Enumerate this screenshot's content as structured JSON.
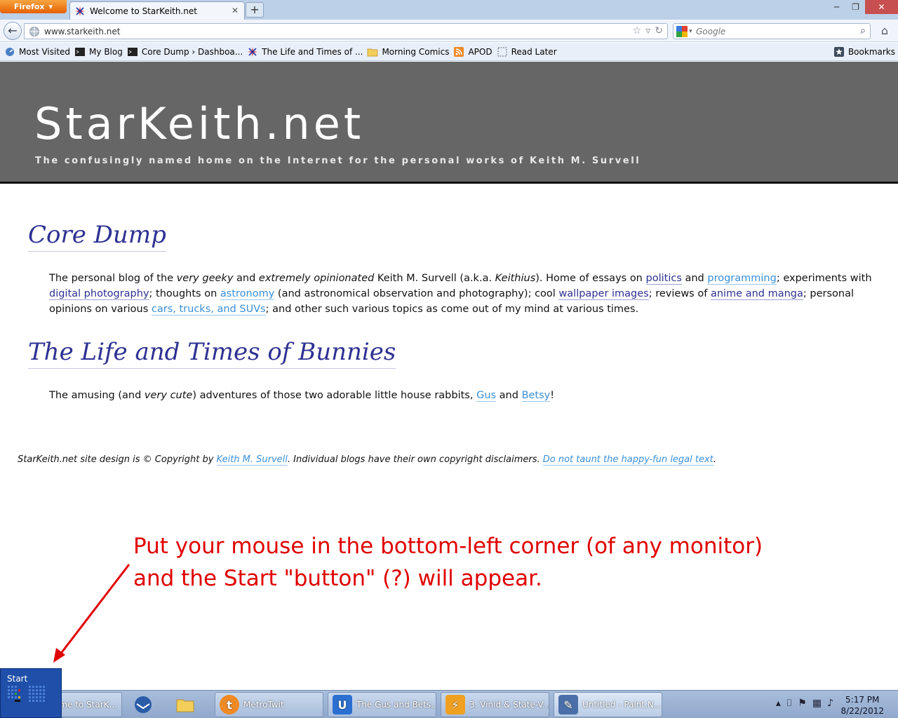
{
  "browser": {
    "app_button": "Firefox",
    "tab_title": "Welcome to StarKeith.net",
    "url": "www.starkeith.net",
    "search_placeholder": "Google",
    "bookmarks": [
      "Most Visited",
      "My Blog",
      "Core Dump › Dashboa...",
      "The Life and Times of ...",
      "Morning Comics",
      "APOD",
      "Read Later"
    ],
    "bookmarks_menu": "Bookmarks"
  },
  "site": {
    "title": "StarKeith.net",
    "tagline": "The confusingly named home on the Internet for the personal works of Keith M. Survell"
  },
  "blogs": [
    {
      "title": "Core Dump",
      "desc": {
        "t1": "The personal blog of the ",
        "e1": "very geeky",
        "t2": " and ",
        "e2": "extremely opinionated",
        "t3": " Keith M. Survell (a.k.a. ",
        "e3": "Keithius",
        "t4": "). Home of essays on ",
        "l1": "politics",
        "t5": " and ",
        "l2": "programming",
        "t6": "; experiments with ",
        "l3": "digital photography",
        "t7": "; thoughts on ",
        "l4": "astronomy",
        "t8": " (and astronomical observation and photography); cool ",
        "l5": "wallpaper images",
        "t9": "; reviews of ",
        "l6": "anime and manga",
        "t10": "; personal opinions on various ",
        "l7": "cars, trucks, and SUVs",
        "t11": "; and other such various topics as come out of my mind at various times."
      }
    },
    {
      "title": "The Life and Times of Bunnies",
      "desc": {
        "t1": "The amusing (and ",
        "e1": "very cute",
        "t2": ") adventures of those two adorable little house rabbits, ",
        "l1": "Gus",
        "t3": " and ",
        "l2": "Betsy",
        "t4": "!"
      }
    }
  ],
  "footer": {
    "t1": "StarKeith.net site design is © Copyright by ",
    "l1": "Keith M. Survell",
    "t2": ". Individual blogs have their own copyright disclaimers. ",
    "l2": "Do not taunt the happy-fun legal text",
    "t3": "."
  },
  "annotation": {
    "line1": "Put your mouse in the bottom-left corner (of any monitor)",
    "line2": "and the Start \"button\" (?) will appear."
  },
  "start_tip": "Start",
  "taskbar": {
    "items": [
      "ome to StarK...",
      "MetroTwit",
      "The Gus and Bets...",
      "3. Vinid & State-V...",
      "Untitled - Paint.N..."
    ],
    "clock_time": "5:17 PM",
    "clock_date": "8/22/2012"
  },
  "colors": {
    "header_bg": "#666666",
    "blog_title": "#2e3192",
    "link_light": "#3a8fd6",
    "annotation": "#e00000",
    "start_tip_bg": "#1f4fa8"
  }
}
